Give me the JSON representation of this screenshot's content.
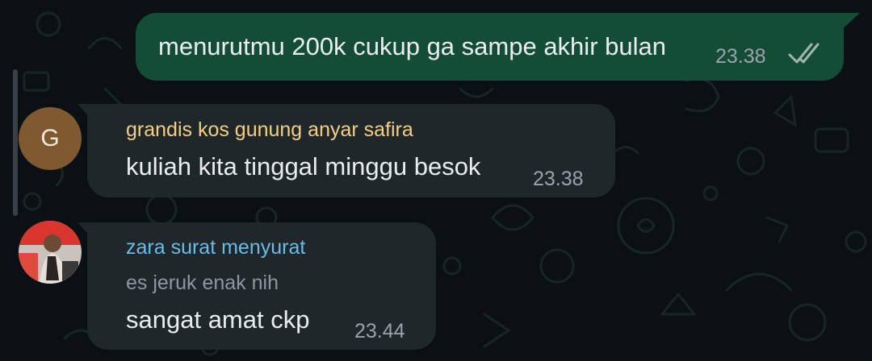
{
  "colors": {
    "background": "#0b1014",
    "outgoing_bubble": "#144d37",
    "incoming_bubble": "#1f272a",
    "sender1": "#f5cf81",
    "sender2": "#6bbbe8",
    "read_ticks": "#9fb6ad"
  },
  "messages": [
    {
      "direction": "outgoing",
      "text": "menurutmu 200k cukup ga sampe akhir bulan",
      "time": "23.38",
      "status_icon": "double-check-icon"
    },
    {
      "direction": "incoming",
      "avatar_initial": "G",
      "sender": "grandis kos gunung anyar safira",
      "text": "kuliah kita tinggal minggu besok",
      "time": "23.38"
    },
    {
      "direction": "incoming",
      "avatar_icon": "profile-photo",
      "sender": "zara surat menyurat",
      "quote": "es jeruk enak nih",
      "text": "sangat amat ckp",
      "time": "23.44"
    }
  ]
}
